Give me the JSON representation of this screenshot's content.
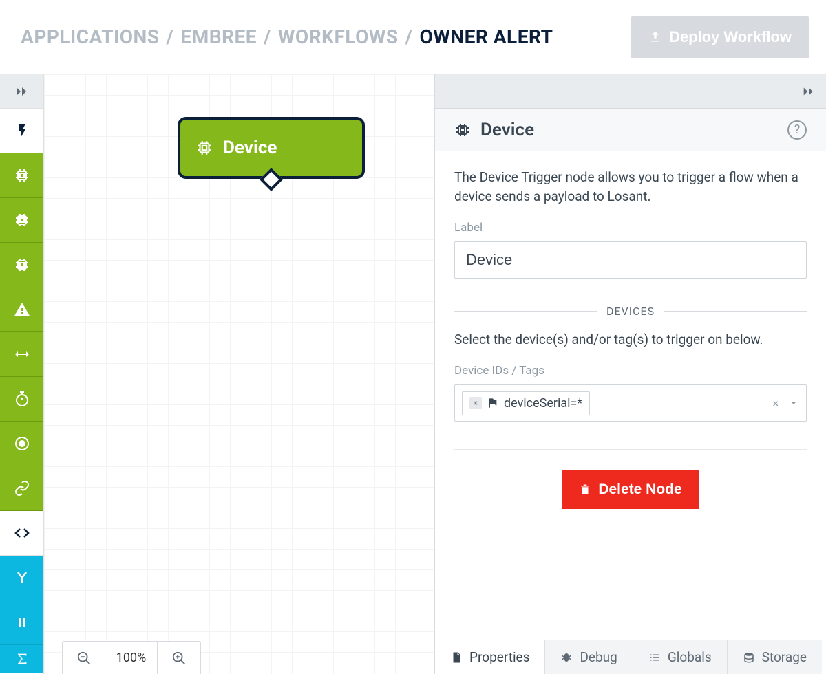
{
  "header": {
    "breadcrumbs": [
      "APPLICATIONS",
      "EMBREE",
      "WORKFLOWS"
    ],
    "current": "OWNER ALERT",
    "deploy_label": "Deploy Workflow"
  },
  "canvas": {
    "node_label": "Device",
    "zoom": "100%"
  },
  "panel": {
    "title": "Device",
    "description": "The Device Trigger node allows you to trigger a flow when a device sends a payload to Losant.",
    "label_field_label": "Label",
    "label_value": "Device",
    "devices_section_title": "DEVICES",
    "devices_help": "Select the device(s) and/or tag(s) to trigger on below.",
    "device_ids_label": "Device IDs / Tags",
    "device_tag": "deviceSerial=*",
    "delete_label": "Delete Node"
  },
  "tabs": {
    "properties": "Properties",
    "debug": "Debug",
    "globals": "Globals",
    "storage": "Storage"
  }
}
